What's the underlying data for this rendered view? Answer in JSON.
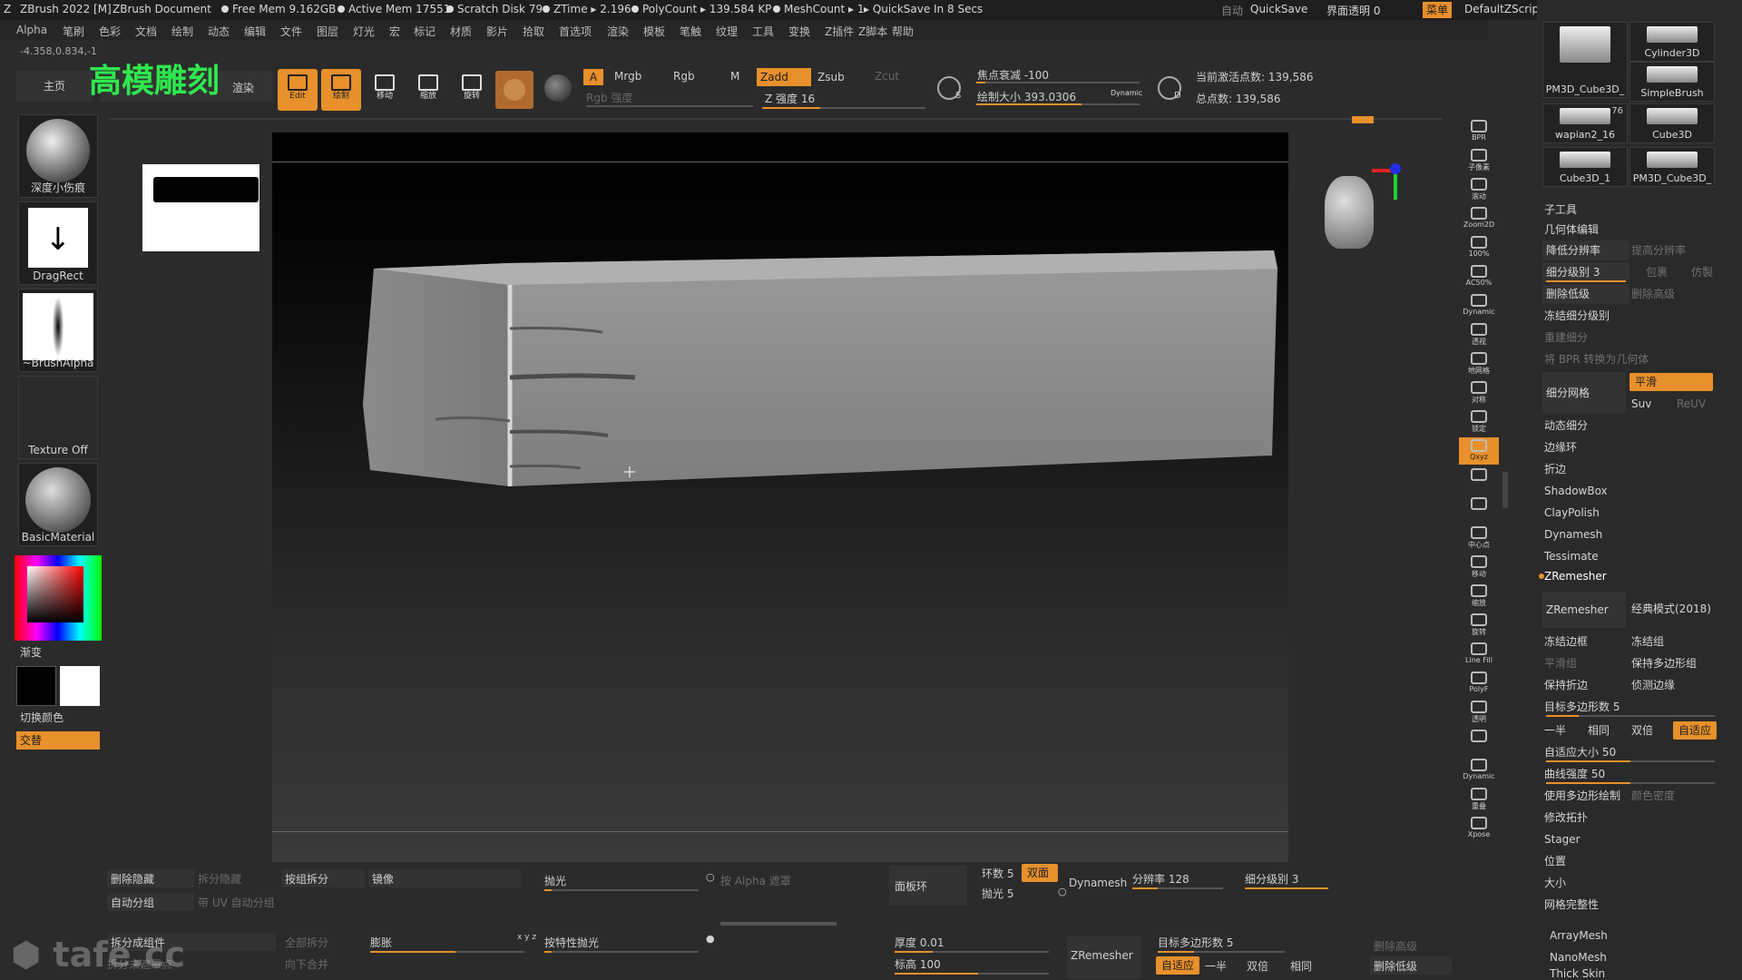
{
  "titlebar": {
    "app": "ZBrush 2022 [M]",
    "doc": "ZBrush Document",
    "free_mem": "Free Mem 9.162GB",
    "active_mem": "Active Mem 17551",
    "scratch": "Scratch Disk 79",
    "ztime": "ZTime ▸ 2.196",
    "polycount": "PolyCount ▸ 139.584 KP",
    "meshcount": "MeshCount ▸ 1",
    "quicksave_status": "▸ QuickSave In 8 Secs",
    "auto": "自动",
    "quicksave": "QuickSave",
    "ui_transparency": "界面透明 0",
    "menu": "菜单",
    "zscript": "DefaultZScript"
  },
  "menubar": [
    "Alpha",
    "笔刷",
    "色彩",
    "文档",
    "绘制",
    "动态",
    "编辑",
    "文件",
    "图层",
    "灯光",
    "宏",
    "标记",
    "材质",
    "影片",
    "拾取",
    "首选项",
    "渲染",
    "模板",
    "笔触",
    "纹理",
    "工具",
    "变换",
    "Z插件",
    "Z脚本",
    "帮助"
  ],
  "coords": "-4.358,0.834,-1",
  "overlay_title": "高模雕刻",
  "shelf": {
    "home": "主页",
    "render_tab": "渲染",
    "edit": "Edit",
    "draw": "绘制",
    "move": "移动",
    "scale": "缩放",
    "rotate": "旋转",
    "a_btn": "A",
    "mrgb": "Mrgb",
    "rgb": "Rgb",
    "m": "M",
    "rgb_intensity": "Rgb 强度",
    "zadd": "Zadd",
    "zsub": "Zsub",
    "zcut": "Zcut",
    "z_intensity": "Z 强度 16",
    "focal": "焦点衰减 -100",
    "draw_size": "绘制大小 393.0306",
    "dynamic": "Dynamic",
    "active_points": "当前激活点数: 139,586",
    "total_points": "总点数: 139,586",
    "s_label": "S",
    "d_label": "D"
  },
  "left": {
    "brush": "深度小伤痕",
    "stroke": "DragRect",
    "alpha": "~BrushAlpha",
    "texture": "Texture Off",
    "material": "BasicMaterial",
    "gradient": "渐变",
    "switch_color": "切换颜色",
    "swap": "交替"
  },
  "right_icons": [
    "BPR",
    "子像素",
    "滚动",
    "Zoom2D",
    "100%",
    "AC50%",
    "Dynamic",
    "透视",
    "地网格",
    "对称",
    "锁定",
    "Qxyz",
    "",
    "",
    "中心点",
    "移动",
    "缩放",
    "旋转",
    "Line Fill",
    "PolyF",
    "透明",
    "",
    "Dynamic",
    "重叠",
    "Xpose"
  ],
  "tools": [
    {
      "name": "PM3D_Cube3D_",
      "count": ""
    },
    {
      "name": "Cylinder3D",
      "count": ""
    },
    {
      "name": "SimpleBrush",
      "count": ""
    },
    {
      "name": "wapian2_16",
      "count": "76"
    },
    {
      "name": "Cube3D",
      "count": ""
    },
    {
      "name": "Cube3D_1",
      "count": ""
    },
    {
      "name": "PM3D_Cube3D_",
      "count": ""
    }
  ],
  "rpanel": {
    "subtool": "子工具",
    "geometry": "几何体编辑",
    "lower_res": "降低分辨率",
    "higher_res": "提高分辨率",
    "sdiv": "细分级别 3",
    "cage": "包裹",
    "rstr": "仿製",
    "del_lower": "删除低级",
    "del_higher": "删除高级",
    "freeze_sub": "冻结细分级别",
    "reconstruct": "重建细分",
    "bpr_geo": "将 BPR 转换为几何体",
    "divide": "细分网格",
    "smooth": "平滑",
    "suv": "Suv",
    "reuv": "ReUV",
    "dynamic_sub": "动态细分",
    "edgeloop": "边缘环",
    "crease": "折边",
    "shadowbox": "ShadowBox",
    "claypolish": "ClayPolish",
    "dynamesh": "Dynamesh",
    "tessimate": "Tessimate",
    "zremesher": "ZRemesher",
    "zremesher_btn": "ZRemesher",
    "legacy": "经典模式(2018)",
    "freeze_border": "冻结边框",
    "freeze_groups": "冻结组",
    "smooth_groups": "平滑组",
    "keep_groups": "保持多边形组",
    "keep_creases": "保持折边",
    "detect_edges": "侦测边缘",
    "target_poly": "目标多边形数 5",
    "half": "一半",
    "same": "相同",
    "double": "双倍",
    "adapt": "自适应",
    "adapt_size": "自适应大小 50",
    "curve_strength": "曲线强度 50",
    "use_polypaint": "使用多边形绘制",
    "color_density": "颜色密度",
    "modify_topo": "修改拓扑",
    "stager": "Stager",
    "position": "位置",
    "size": "大小",
    "mesh_integrity": "网格完整性",
    "arraymesh": "ArrayMesh",
    "nanomesh": "NanoMesh",
    "thickskin": "Thick Skin"
  },
  "bottom": {
    "del_hidden": "删除隐藏",
    "split_hidden": "拆分隐藏",
    "groups_split": "按组拆分",
    "mirror": "镜像",
    "polish": "抛光",
    "by_alpha": "按 Alpha 遮罩",
    "panel_loops": "面板环",
    "loops": "环数 5",
    "double": "双面",
    "polish2": "抛光 5",
    "dynamesh": "Dynamesh",
    "resolution": "分辨率 128",
    "sdiv": "细分级别 3",
    "auto_groups": "自动分组",
    "uv_groups": "带 UV 自动分组",
    "split_to_parts": "拆分成组件",
    "all_split": "全部拆分",
    "inflate": "膨胀",
    "xyz": "x y z",
    "feature_polish": "按特性抛光",
    "thickness": "厚度 0.01",
    "elevation": "标高 100",
    "zremesher": "ZRemesher",
    "target_poly": "目标多边形数 5",
    "adapt": "自适应",
    "half": "一半",
    "double2": "双倍",
    "same": "相同",
    "merge_down": "向下合并",
    "del_higher": "删除高级",
    "del_lower": "删除低级",
    "split_unmasked": "拆分未遮罩点"
  },
  "watermark": "tafe.cc",
  "colors": {
    "accent": "#e8902b",
    "overlay": "#2ee84d"
  }
}
